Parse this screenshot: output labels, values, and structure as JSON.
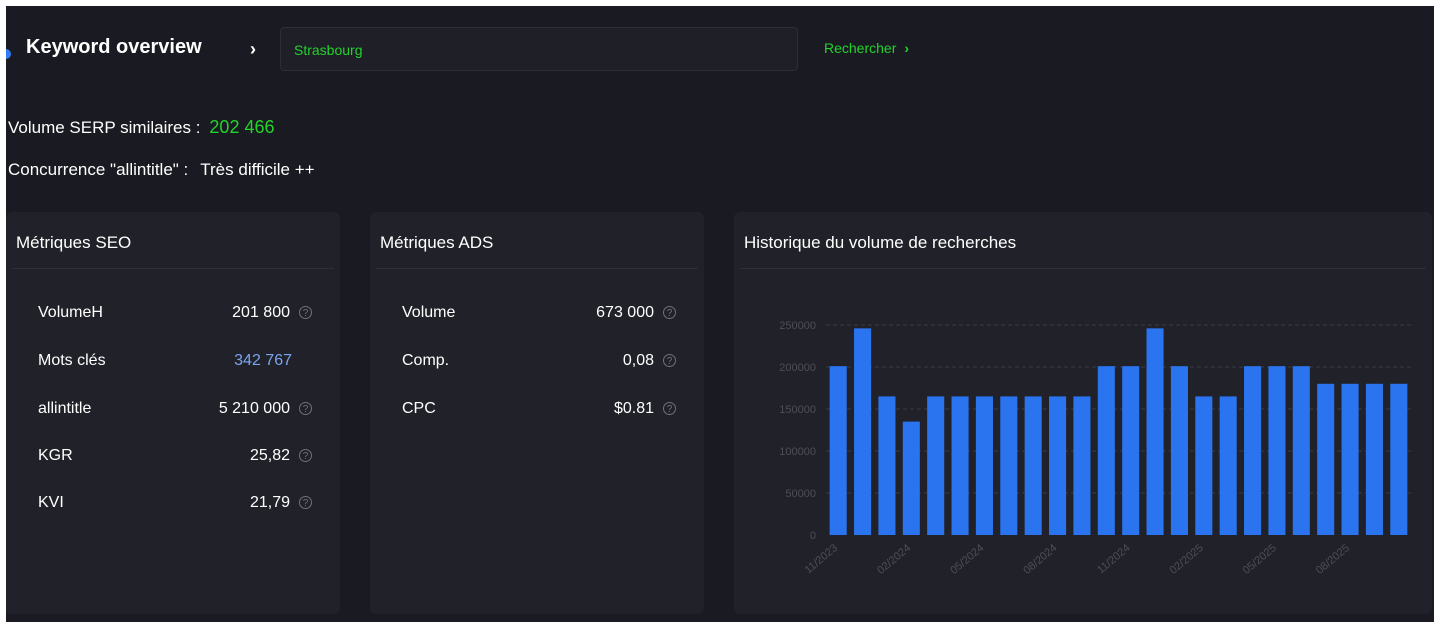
{
  "header": {
    "title": "Keyword overview",
    "title_chevron": "›",
    "search_value": "Strasbourg",
    "search_button": "Rechercher",
    "search_button_chevron": "›"
  },
  "summary": {
    "serp_label": "Volume SERP similaires :",
    "serp_value": "202 466",
    "competition_label": "Concurrence \"allintitle\" :",
    "competition_value": "Très difficile ++"
  },
  "seo": {
    "title": "Métriques SEO",
    "rows": [
      {
        "label": "VolumeH",
        "value": "201 800",
        "help": true
      },
      {
        "label": "Mots clés",
        "value": "342 767",
        "help": false
      },
      {
        "label": "allintitle",
        "value": "5 210 000",
        "help": true
      },
      {
        "label": "KGR",
        "value": "25,82",
        "help": true
      },
      {
        "label": "KVI",
        "value": "21,79",
        "help": true
      }
    ]
  },
  "ads": {
    "title": "Métriques ADS",
    "rows": [
      {
        "label": "Volume",
        "value": "673 000",
        "help": true
      },
      {
        "label": "Comp.",
        "value": "0,08",
        "help": true
      },
      {
        "label": "CPC",
        "value": "$0.81",
        "help": true
      }
    ]
  },
  "history": {
    "title": "Historique du volume de recherches"
  },
  "chart_data": {
    "type": "bar",
    "title": "Historique du volume de recherches",
    "xlabel": "",
    "ylabel": "",
    "ylim": [
      0,
      250000
    ],
    "yticks": [
      0,
      50000,
      100000,
      150000,
      200000,
      250000
    ],
    "grid": true,
    "bar_color": "#2a74f0",
    "categories": [
      "11/2023",
      "12/2023",
      "01/2024",
      "02/2024",
      "03/2024",
      "04/2024",
      "05/2024",
      "06/2024",
      "07/2024",
      "08/2024",
      "09/2024",
      "10/2024",
      "11/2024",
      "12/2024",
      "01/2025",
      "02/2025",
      "03/2025",
      "04/2025",
      "05/2025",
      "06/2025",
      "07/2025",
      "08/2025",
      "09/2025",
      "10/2025"
    ],
    "tick_labels_shown": [
      "11/2023",
      "02/2024",
      "05/2024",
      "08/2024",
      "11/2024",
      "02/2025",
      "05/2025",
      "08/2025"
    ],
    "values": [
      201000,
      246000,
      165000,
      135000,
      165000,
      165000,
      165000,
      165000,
      165000,
      165000,
      165000,
      201000,
      201000,
      246000,
      201000,
      165000,
      165000,
      201000,
      201000,
      201000,
      180000,
      180000,
      180000,
      180000
    ]
  },
  "colors": {
    "background": "#1a1b22",
    "panel": "#212229",
    "accent_green": "#22d32a",
    "accent_blue": "#2f7cf6",
    "value_blue": "#7aa4ee"
  }
}
